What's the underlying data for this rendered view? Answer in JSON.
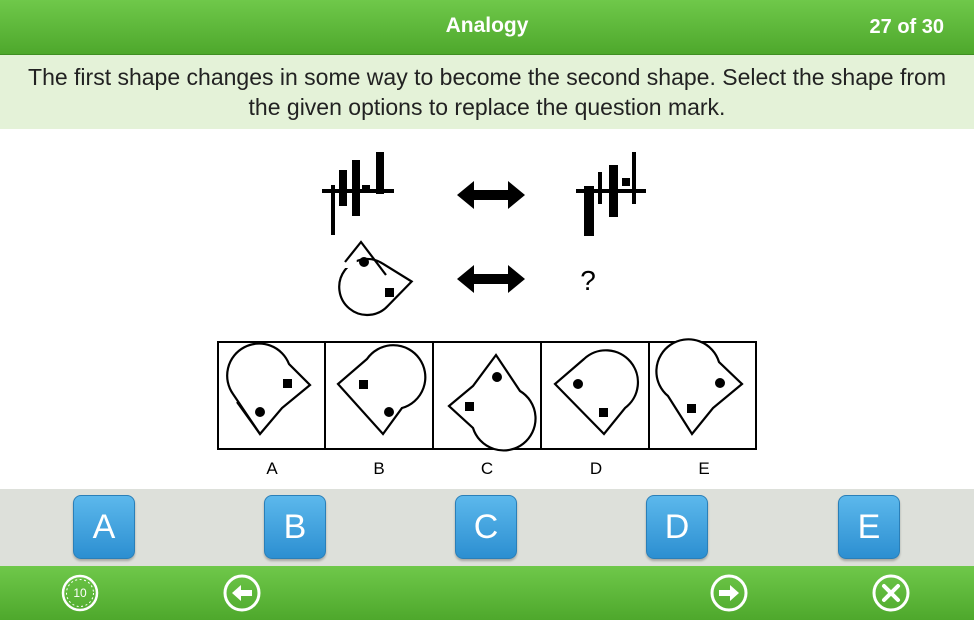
{
  "header": {
    "title": "Analogy",
    "progress": "27 of 30"
  },
  "instruction": "The first shape changes in some way to become the second shape. Select the shape from the given options to replace the question mark.",
  "puzzle": {
    "question_mark": "?",
    "option_labels": [
      "A",
      "B",
      "C",
      "D",
      "E"
    ]
  },
  "answers": [
    "A",
    "B",
    "C",
    "D",
    "E"
  ],
  "footer": {
    "timer": "10"
  },
  "colors": {
    "green": "#4ea82c",
    "blue": "#2c8fd1",
    "answer_bar": "#dde0da"
  },
  "icons": {
    "timer": "timer-icon",
    "back": "back-arrow-icon",
    "next": "next-arrow-icon",
    "close": "close-icon"
  }
}
